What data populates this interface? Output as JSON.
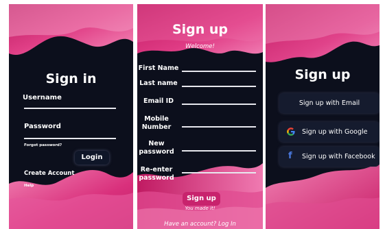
{
  "signin": {
    "title": "Sign in",
    "username_label": "Username",
    "password_label": "Password",
    "forgot_link": "Forgot password?",
    "login_button": "Login",
    "create_account": "Create Account",
    "help": "Help"
  },
  "signup_form": {
    "title": "Sign up",
    "welcome": "Welcome!",
    "fields": [
      {
        "label": "First Name"
      },
      {
        "label": "Last name"
      },
      {
        "label": "Email ID"
      },
      {
        "label": "Mobile Number"
      },
      {
        "label": "New password"
      },
      {
        "label": "Re-enter password"
      }
    ],
    "signup_button": "Sign up",
    "tagline": "You made it!",
    "login_prompt": "Have an account? Log In"
  },
  "signup_options": {
    "title": "Sign up",
    "buttons": [
      {
        "label": "Sign up with Email",
        "icon": null
      },
      {
        "label": "Sign up with Google",
        "icon": "google-icon"
      },
      {
        "label": "Sign up with Facebook",
        "icon": "facebook-icon"
      }
    ]
  },
  "colors": {
    "background": "#0c0f1c",
    "wave_pink": "#d8307a",
    "wave_light": "#f080b4",
    "button_pink": "#c8236d",
    "button_dark": "#0f1628"
  }
}
